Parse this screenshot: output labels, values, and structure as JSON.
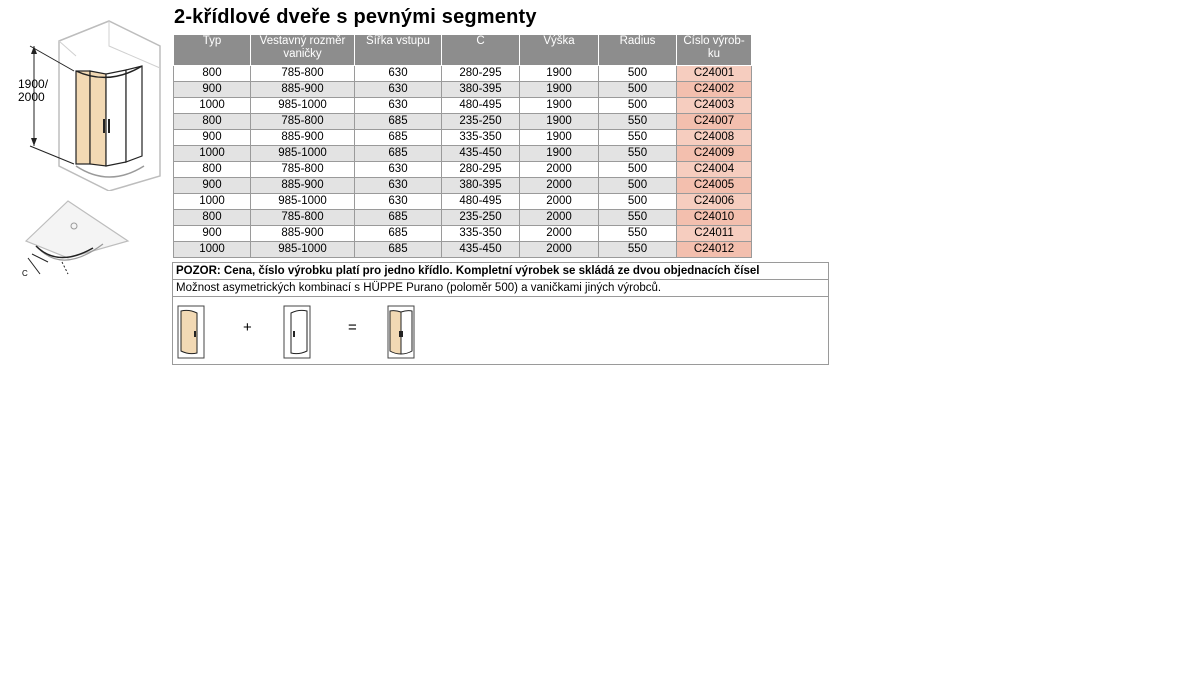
{
  "title": "2-křídlové dveře s pevnými segmenty",
  "diagram": {
    "height_label_1": "1900/",
    "height_label_2": "2000",
    "plan_label": "C"
  },
  "table": {
    "headers": [
      {
        "line1": "Typ",
        "line2": ""
      },
      {
        "line1": "Vestavný rozměr",
        "line2": "vaničky"
      },
      {
        "line1": "Šířka vstupu",
        "line2": ""
      },
      {
        "line1": "C",
        "line2": ""
      },
      {
        "line1": "Výška",
        "line2": ""
      },
      {
        "line1": "Radius",
        "line2": ""
      },
      {
        "line1": "Číslo výrob-",
        "line2": "ku"
      }
    ],
    "rows": [
      [
        "800",
        "785-800",
        "630",
        "280-295",
        "1900",
        "500",
        "C24001"
      ],
      [
        "900",
        "885-900",
        "630",
        "380-395",
        "1900",
        "500",
        "C24002"
      ],
      [
        "1000",
        "985-1000",
        "630",
        "480-495",
        "1900",
        "500",
        "C24003"
      ],
      [
        "800",
        "785-800",
        "685",
        "235-250",
        "1900",
        "550",
        "C24007"
      ],
      [
        "900",
        "885-900",
        "685",
        "335-350",
        "1900",
        "550",
        "C24008"
      ],
      [
        "1000",
        "985-1000",
        "685",
        "435-450",
        "1900",
        "550",
        "C24009"
      ],
      [
        "800",
        "785-800",
        "630",
        "280-295",
        "2000",
        "500",
        "C24004"
      ],
      [
        "900",
        "885-900",
        "630",
        "380-395",
        "2000",
        "500",
        "C24005"
      ],
      [
        "1000",
        "985-1000",
        "630",
        "480-495",
        "2000",
        "500",
        "C24006"
      ],
      [
        "800",
        "785-800",
        "685",
        "235-250",
        "2000",
        "550",
        "C24010"
      ],
      [
        "900",
        "885-900",
        "685",
        "335-350",
        "2000",
        "550",
        "C24011"
      ],
      [
        "1000",
        "985-1000",
        "685",
        "435-450",
        "2000",
        "550",
        "C24012"
      ]
    ]
  },
  "notes": {
    "warning": "POZOR: Cena, číslo výrobku platí pro jedno křídlo. Kompletní výrobek se skládá ze dvou objednacích čísel",
    "asymmetric": "Možnost asymetrických kombinací s HÜPPE Purano (poloměr 500) a vaničkami jiných výrobců.",
    "plus": "+",
    "equals": "="
  },
  "colors": {
    "header_bg": "#8d8d8d",
    "alt_row": "#e3e3e3",
    "code_cell": "#f6cdbf",
    "door_glass": "#f2d9b4"
  }
}
